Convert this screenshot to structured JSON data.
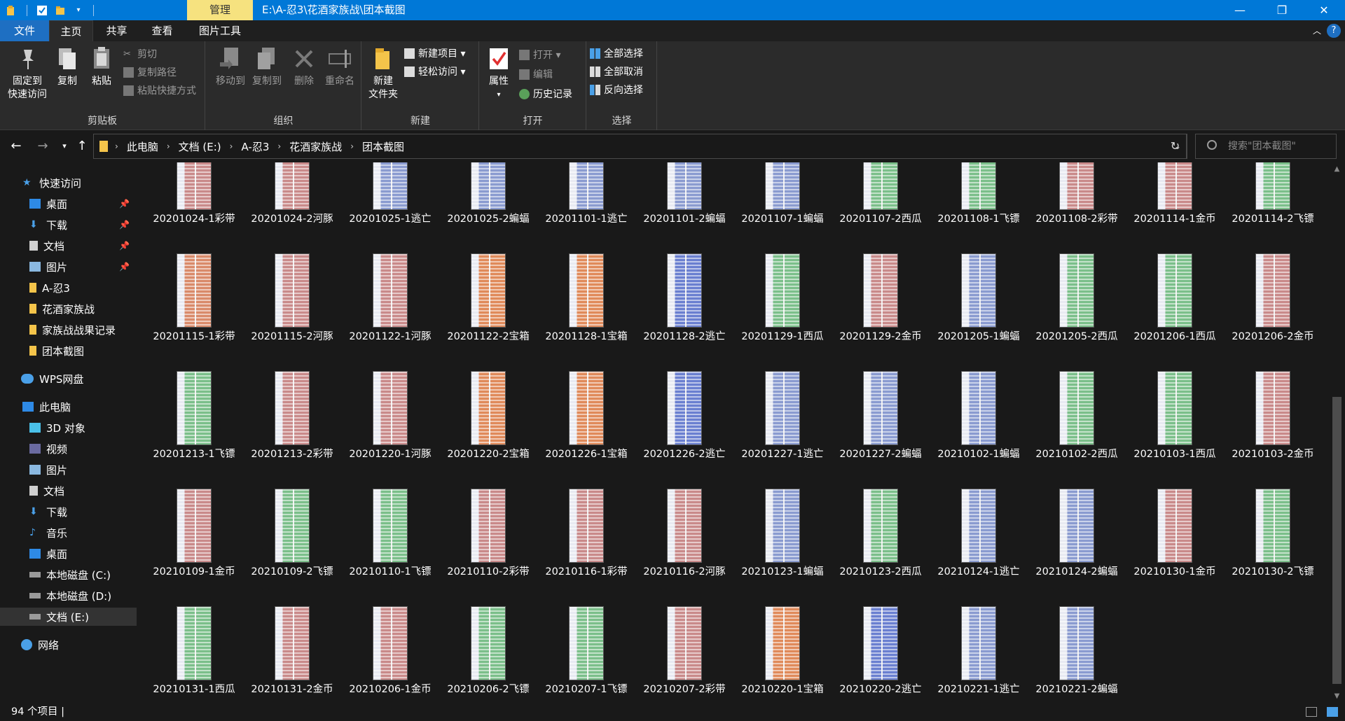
{
  "window": {
    "context_tab": "管理",
    "path_title": "E:\\A-忍3\\花酒家族战\\团本截图",
    "minimize": "—",
    "maximize": "❐",
    "close": "✕"
  },
  "tabs": [
    {
      "label": "文件"
    },
    {
      "label": "主页"
    },
    {
      "label": "共享"
    },
    {
      "label": "查看"
    },
    {
      "label": "图片工具"
    }
  ],
  "ribbon": {
    "clipboard": {
      "pin_label": "固定到\n快速访问",
      "copy": "复制",
      "paste": "粘贴",
      "cut": "剪切",
      "copy_path": "复制路径",
      "paste_shortcut": "粘贴快捷方式",
      "group": "剪贴板"
    },
    "organize": {
      "move_to": "移动到",
      "copy_to": "复制到",
      "delete": "删除",
      "rename": "重命名",
      "group": "组织"
    },
    "new": {
      "new_folder": "新建\n文件夹",
      "new_item": "新建项目 ▾",
      "easy_access": "轻松访问 ▾",
      "group": "新建"
    },
    "open": {
      "properties": "属性",
      "open": "打开 ▾",
      "edit": "编辑",
      "history": "历史记录",
      "group": "打开"
    },
    "select": {
      "select_all": "全部选择",
      "select_none": "全部取消",
      "invert": "反向选择",
      "group": "选择"
    }
  },
  "address": {
    "crumbs": [
      "此电脑",
      "文档 (E:)",
      "A-忍3",
      "花酒家族战",
      "团本截图"
    ],
    "search_placeholder": "搜索\"团本截图\""
  },
  "nav": {
    "quick_access": "快速访问",
    "quick_items": [
      "桌面",
      "下载",
      "文档",
      "图片",
      "A-忍3",
      "花酒家族战",
      "家族战战果记录",
      "团本截图"
    ],
    "wps": "WPS网盘",
    "this_pc": "此电脑",
    "pc_items": [
      "3D 对象",
      "视频",
      "图片",
      "文档",
      "下载",
      "音乐",
      "桌面",
      "本地磁盘 (C:)",
      "本地磁盘 (D:)",
      "文档 (E:)"
    ],
    "network": "网络"
  },
  "files": [
    {
      "name": "20201024-1彩带",
      "tint": "#c98a8a"
    },
    {
      "name": "20201024-2河豚",
      "tint": "#c98a8a"
    },
    {
      "name": "20201025-1逃亡",
      "tint": "#8a9bd0"
    },
    {
      "name": "20201025-2蝙蝠",
      "tint": "#8a9bd0"
    },
    {
      "name": "20201101-1逃亡",
      "tint": "#8a9bd0"
    },
    {
      "name": "20201101-2蝙蝠",
      "tint": "#8a9bd0"
    },
    {
      "name": "20201107-1蝙蝠",
      "tint": "#8a9bd0"
    },
    {
      "name": "20201107-2西瓜",
      "tint": "#7bbf8a"
    },
    {
      "name": "20201108-1飞镖",
      "tint": "#7bbf8a"
    },
    {
      "name": "20201108-2彩带",
      "tint": "#c98a8a"
    },
    {
      "name": "20201114-1金币",
      "tint": "#c98a8a"
    },
    {
      "name": "20201114-2飞镖",
      "tint": "#7bbf8a"
    },
    {
      "name": "20201115-1彩带",
      "tint": "#d98a6a"
    },
    {
      "name": "20201115-2河豚",
      "tint": "#c98a8a"
    },
    {
      "name": "20201122-1河豚",
      "tint": "#c98a8a"
    },
    {
      "name": "20201122-2宝箱",
      "tint": "#e08a5a"
    },
    {
      "name": "20201128-1宝箱",
      "tint": "#e08a5a"
    },
    {
      "name": "20201128-2逃亡",
      "tint": "#6a7fd0"
    },
    {
      "name": "20201129-1西瓜",
      "tint": "#7bbf8a"
    },
    {
      "name": "20201129-2金币",
      "tint": "#c98a8a"
    },
    {
      "name": "20201205-1蝙蝠",
      "tint": "#8a9bd0"
    },
    {
      "name": "20201205-2西瓜",
      "tint": "#7bbf8a"
    },
    {
      "name": "20201206-1西瓜",
      "tint": "#7bbf8a"
    },
    {
      "name": "20201206-2金币",
      "tint": "#c98a8a"
    },
    {
      "name": "20201213-1飞镖",
      "tint": "#7bbf8a"
    },
    {
      "name": "20201213-2彩带",
      "tint": "#c98a8a"
    },
    {
      "name": "20201220-1河豚",
      "tint": "#c98a8a"
    },
    {
      "name": "20201220-2宝箱",
      "tint": "#e08a5a"
    },
    {
      "name": "20201226-1宝箱",
      "tint": "#e08a5a"
    },
    {
      "name": "20201226-2逃亡",
      "tint": "#6a7fd0"
    },
    {
      "name": "20201227-1逃亡",
      "tint": "#8a9bd0"
    },
    {
      "name": "20201227-2蝙蝠",
      "tint": "#8a9bd0"
    },
    {
      "name": "20210102-1蝙蝠",
      "tint": "#8a9bd0"
    },
    {
      "name": "20210102-2西瓜",
      "tint": "#7bbf8a"
    },
    {
      "name": "20210103-1西瓜",
      "tint": "#7bbf8a"
    },
    {
      "name": "20210103-2金币",
      "tint": "#c98a8a"
    },
    {
      "name": "20210109-1金币",
      "tint": "#c98a8a"
    },
    {
      "name": "20210109-2飞镖",
      "tint": "#7bbf8a"
    },
    {
      "name": "20210110-1飞镖",
      "tint": "#7bbf8a"
    },
    {
      "name": "20210110-2彩带",
      "tint": "#c98a8a"
    },
    {
      "name": "20210116-1彩带",
      "tint": "#c98a8a"
    },
    {
      "name": "20210116-2河豚",
      "tint": "#c98a8a"
    },
    {
      "name": "20210123-1蝙蝠",
      "tint": "#8a9bd0"
    },
    {
      "name": "20210123-2西瓜",
      "tint": "#7bbf8a"
    },
    {
      "name": "20210124-1逃亡",
      "tint": "#8a9bd0"
    },
    {
      "name": "20210124-2蝙蝠",
      "tint": "#8a9bd0"
    },
    {
      "name": "20210130-1金币",
      "tint": "#c98a8a"
    },
    {
      "name": "20210130-2飞镖",
      "tint": "#7bbf8a"
    },
    {
      "name": "20210131-1西瓜",
      "tint": "#7bbf8a"
    },
    {
      "name": "20210131-2金币",
      "tint": "#c98a8a"
    },
    {
      "name": "20210206-1金币",
      "tint": "#c98a8a"
    },
    {
      "name": "20210206-2飞镖",
      "tint": "#7bbf8a"
    },
    {
      "name": "20210207-1飞镖",
      "tint": "#7bbf8a"
    },
    {
      "name": "20210207-2彩带",
      "tint": "#c98a8a"
    },
    {
      "name": "20210220-1宝箱",
      "tint": "#e08a5a"
    },
    {
      "name": "20210220-2逃亡",
      "tint": "#6a7fd0"
    },
    {
      "name": "20210221-1逃亡",
      "tint": "#8a9bd0"
    },
    {
      "name": "20210221-2蝙蝠",
      "tint": "#8a9bd0"
    }
  ],
  "status": {
    "count": "94 个项目  |"
  },
  "colors": {
    "accent": "#0078d7",
    "context_tab": "#f6e27f",
    "folder": "#f4c44a",
    "background": "#191919"
  }
}
